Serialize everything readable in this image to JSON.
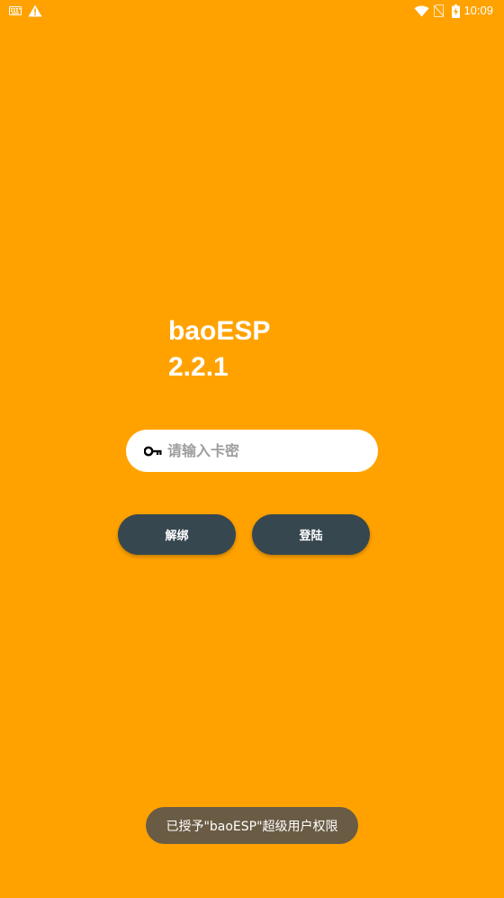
{
  "status_bar": {
    "time": "10:09",
    "icons": [
      "keyboard-icon",
      "warning-icon",
      "wifi-icon",
      "no-sim-icon",
      "battery-charging-icon"
    ]
  },
  "app": {
    "name": "baoESP",
    "version": "2.2.1"
  },
  "login": {
    "input_placeholder": "请输入卡密",
    "input_value": "",
    "unbind_label": "解绑",
    "login_label": "登陆"
  },
  "toast": {
    "message": "已授予\"baoESP\"超级用户权限"
  },
  "colors": {
    "background": "#FFA200",
    "button": "#37474F",
    "input_bg": "#FFFFFF",
    "toast_bg": "#505050"
  }
}
